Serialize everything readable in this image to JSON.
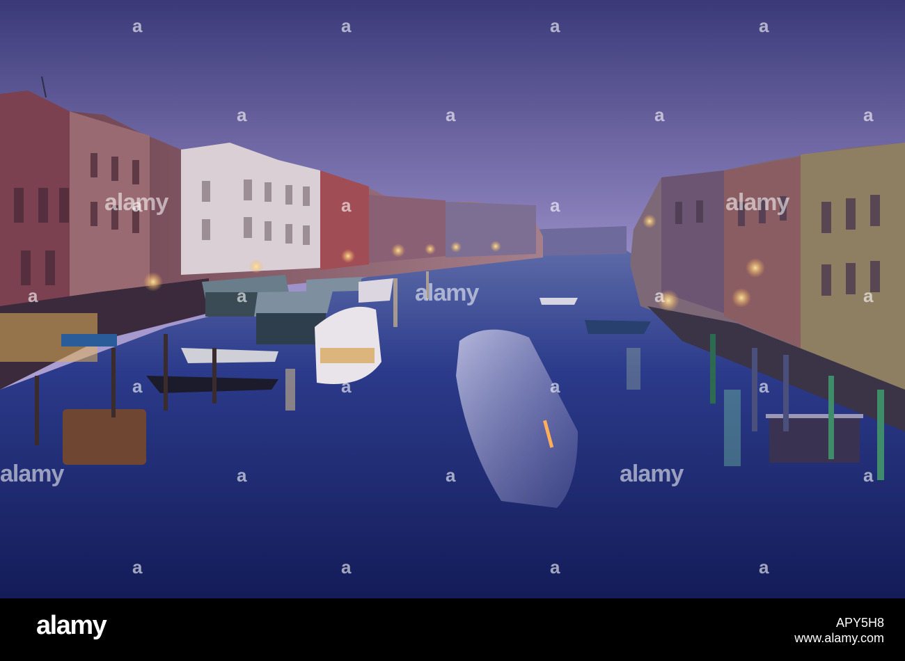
{
  "watermark": {
    "word": "alamy",
    "glyph": "a"
  },
  "footer": {
    "logo": "alamy",
    "url": "www.alamy.com",
    "image_id": "APY5H8"
  },
  "colors": {
    "sky_top": "#3b3a7a",
    "sky_bottom": "#c9b9de",
    "water": "#1f2a6b",
    "footer": "#000000"
  }
}
